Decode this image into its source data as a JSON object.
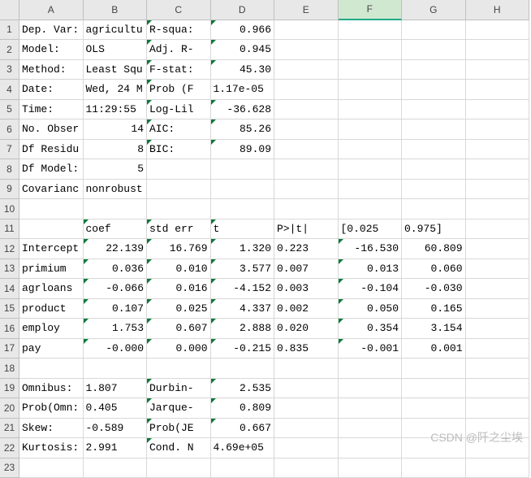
{
  "columns": [
    "A",
    "B",
    "C",
    "D",
    "E",
    "F",
    "G",
    "H"
  ],
  "active_col": "F",
  "rows": 23,
  "cells": {
    "A1": "Dep. Var:",
    "B1": "agricultu",
    "C1": "R-squa:",
    "D1": "0.966",
    "A2": "Model:",
    "B2": "OLS",
    "C2": "Adj. R-",
    "D2": "0.945",
    "A3": "Method:",
    "B3": "Least Squ",
    "C3": "F-stat:",
    "D3": "45.30",
    "A4": "Date:",
    "B4": "Wed, 24 M",
    "C4": "Prob (F",
    "D4": "1.17e-05",
    "A5": "Time:",
    "B5": "11:29:55",
    "C5": "Log-Lil",
    "D5": "-36.628",
    "A6": "No. Obser",
    "B6": "14",
    "C6": "AIC:",
    "D6": "85.26",
    "A7": "Df Residu",
    "B7": "8",
    "C7": "BIC:",
    "D7": "89.09",
    "A8": "Df Model:",
    "B8": "5",
    "A9": "Covarianc",
    "B9": "nonrobust",
    "B11": "coef",
    "C11": "std err",
    "D11": "t",
    "E11": "P>|t|",
    "F11": "[0.025",
    "G11": "0.975]",
    "A12": "Intercept",
    "B12": "22.139",
    "C12": "16.769",
    "D12": "1.320",
    "E12": "0.223",
    "F12": "-16.530",
    "G12": "60.809",
    "A13": "primium",
    "B13": "0.036",
    "C13": "0.010",
    "D13": "3.577",
    "E13": "0.007",
    "F13": "0.013",
    "G13": "0.060",
    "A14": "agrloans",
    "B14": "-0.066",
    "C14": "0.016",
    "D14": "-4.152",
    "E14": "0.003",
    "F14": "-0.104",
    "G14": "-0.030",
    "A15": "product",
    "B15": "0.107",
    "C15": "0.025",
    "D15": "4.337",
    "E15": "0.002",
    "F15": "0.050",
    "G15": "0.165",
    "A16": "employ",
    "B16": "1.753",
    "C16": "0.607",
    "D16": "2.888",
    "E16": "0.020",
    "F16": "0.354",
    "G16": "3.154",
    "A17": "pay",
    "B17": "-0.000",
    "C17": "0.000",
    "D17": "-0.215",
    "E17": "0.835",
    "F17": "-0.001",
    "G17": "0.001",
    "A19": "Omnibus:",
    "B19": "1.807",
    "C19": "Durbin-",
    "D19": "2.535",
    "A20": "Prob(Omn:",
    "B20": "0.405",
    "C20": "Jarque-",
    "D20": "0.809",
    "A21": "Skew:",
    "B21": "-0.589",
    "C21": "Prob(JE",
    "D21": "0.667",
    "A22": "Kurtosis:",
    "B22": "2.991",
    "C22": "Cond. N",
    "D22": "4.69e+05"
  },
  "text_cells": [
    "A",
    "B11",
    "C11",
    "D11",
    "E11",
    "F11",
    "G11",
    "C",
    "B1",
    "B2",
    "B3",
    "B4",
    "B5",
    "B9",
    "D4",
    "D22"
  ],
  "tri_cells": [
    "C1",
    "D1",
    "C2",
    "D2",
    "C3",
    "D3",
    "C4",
    "C5",
    "D5",
    "C6",
    "D6",
    "C7",
    "D7",
    "B11",
    "C11",
    "D11",
    "B12",
    "C12",
    "D12",
    "F12",
    "B13",
    "C13",
    "D13",
    "F13",
    "B14",
    "C14",
    "D14",
    "F14",
    "B15",
    "C15",
    "D15",
    "F15",
    "B16",
    "C16",
    "D16",
    "F16",
    "B17",
    "C17",
    "D17",
    "F17",
    "C19",
    "D19",
    "C20",
    "D20",
    "C21",
    "D21",
    "C22"
  ],
  "right_cells": [
    "D1",
    "D2",
    "D3",
    "D5",
    "D6",
    "D7",
    "B6",
    "B7",
    "B8",
    "B12",
    "C12",
    "D12",
    "F12",
    "G12",
    "B13",
    "C13",
    "D13",
    "F13",
    "G13",
    "B14",
    "C14",
    "D14",
    "F14",
    "G14",
    "B15",
    "C15",
    "D15",
    "F15",
    "G15",
    "B16",
    "C16",
    "D16",
    "F16",
    "G16",
    "B17",
    "C17",
    "D17",
    "F17",
    "G17",
    "D19",
    "D20",
    "D21"
  ],
  "watermark": "CSDN @阡之尘埃"
}
